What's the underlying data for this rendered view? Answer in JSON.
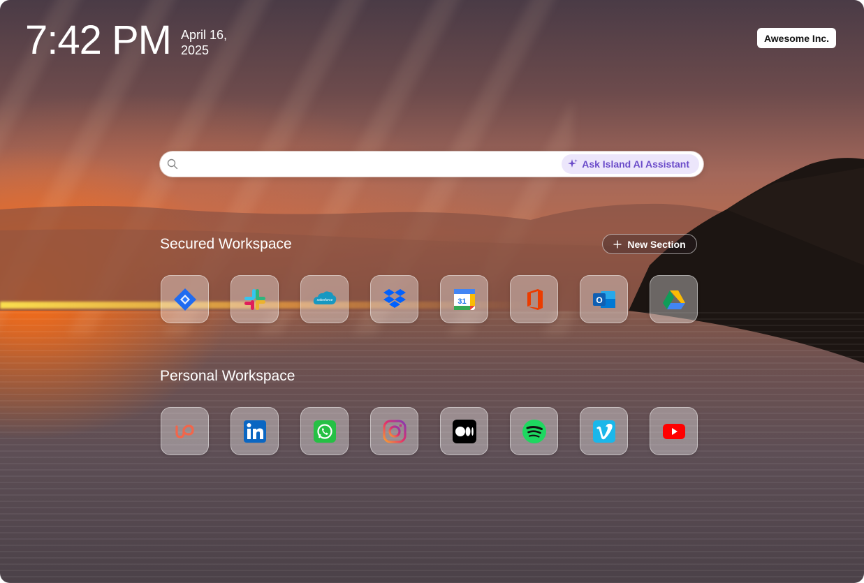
{
  "clock": {
    "time": "7:42 PM",
    "date_line1": "April 16,",
    "date_line2": "2025"
  },
  "org": {
    "name": "Awesome Inc."
  },
  "search": {
    "placeholder": "",
    "ai_button_label": "Ask Island AI Assistant"
  },
  "secured": {
    "title": "Secured Workspace",
    "new_section_label": "New Section",
    "apps": [
      {
        "name": "Jira",
        "icon": "jira-icon"
      },
      {
        "name": "Slack",
        "icon": "slack-icon"
      },
      {
        "name": "salesforce",
        "icon": "salesforce-icon"
      },
      {
        "name": "Dropbox",
        "icon": "dropbox-icon"
      },
      {
        "name": "Google Calendar",
        "icon": "google-calendar-icon"
      },
      {
        "name": "Office",
        "icon": "office-icon"
      },
      {
        "name": "Outlook",
        "icon": "outlook-icon"
      },
      {
        "name": "Google Drive",
        "icon": "google-drive-icon"
      }
    ]
  },
  "personal": {
    "title": "Personal Workspace",
    "apps": [
      {
        "name": "Upwork",
        "icon": "upwork-icon"
      },
      {
        "name": "LinkedIn",
        "icon": "linkedin-icon"
      },
      {
        "name": "WhatsApp",
        "icon": "whatsapp-icon"
      },
      {
        "name": "Instagram",
        "icon": "instagram-icon"
      },
      {
        "name": "Medium",
        "icon": "medium-icon"
      },
      {
        "name": "Spotify",
        "icon": "spotify-icon"
      },
      {
        "name": "Vimeo",
        "icon": "vimeo-icon"
      },
      {
        "name": "YouTube",
        "icon": "youtube-icon"
      }
    ]
  },
  "calendar_day": "31",
  "colors": {
    "ai_accent": "#6a4bc9",
    "ai_bg": "#ece6fb"
  }
}
